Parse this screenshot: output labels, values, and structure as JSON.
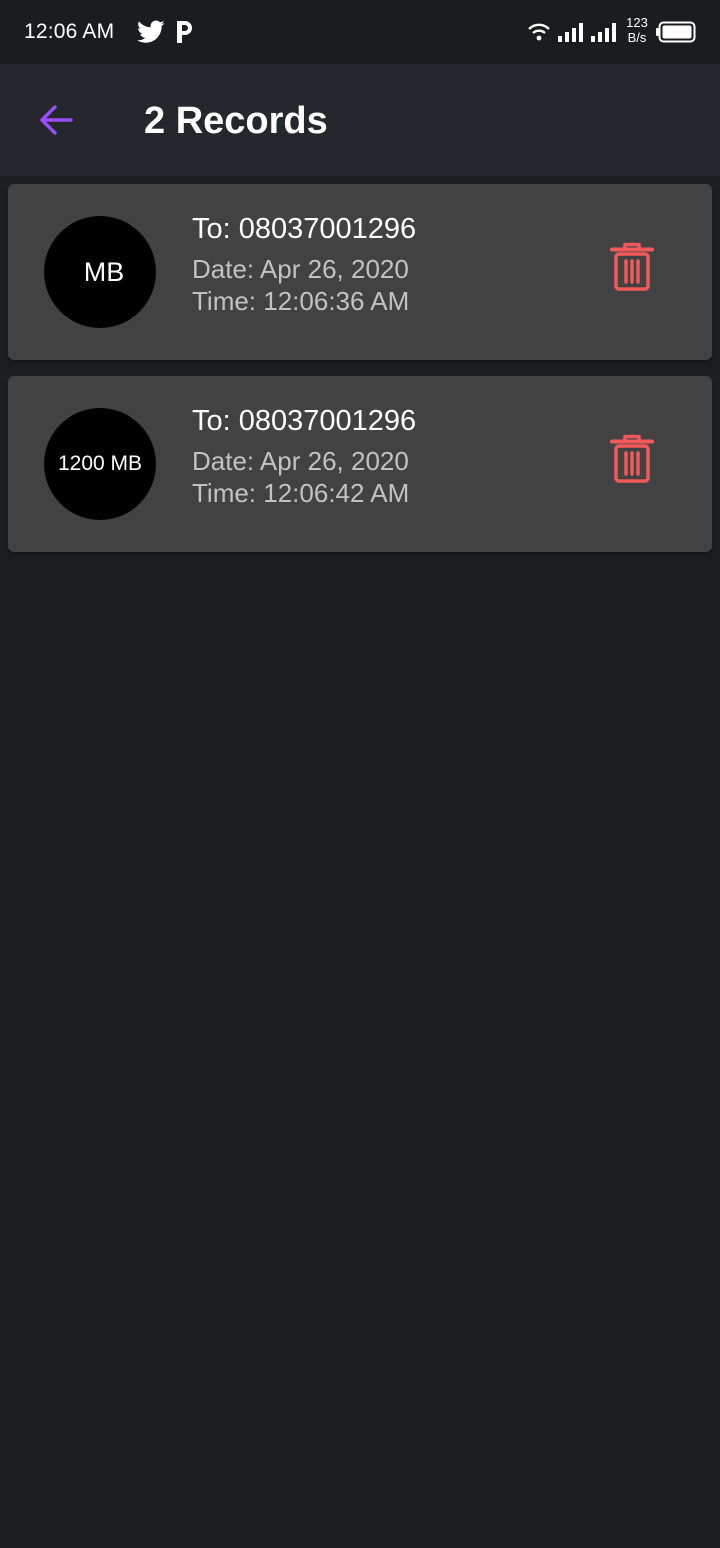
{
  "status_bar": {
    "time": "12:06 AM",
    "notification_icons": [
      "twitter-icon",
      "p-app-icon"
    ],
    "network_speed_value": "123",
    "network_speed_unit": "B/s",
    "system_icons": [
      "wifi-icon",
      "signal-icon",
      "signal-icon",
      "battery-icon"
    ]
  },
  "app_bar": {
    "back_icon": "arrow-left-icon",
    "title": "2 Records"
  },
  "records": [
    {
      "size_label": "MB",
      "to": "To: 08037001296",
      "date": "Date: Apr 26, 2020",
      "time": "Time: 12:06:36 AM",
      "action_icon": "trash-icon"
    },
    {
      "size_label": "1200 MB",
      "to": "To: 08037001296",
      "date": "Date: Apr 26, 2020",
      "time": "Time: 12:06:42 AM",
      "action_icon": "trash-icon"
    }
  ],
  "colors": {
    "background": "#1d1e22",
    "app_bar": "#26272c",
    "card": "#424242",
    "accent": "#9c4dff",
    "delete": "#f25a5a",
    "text_primary": "#ffffff",
    "text_secondary": "#c2c2c2"
  }
}
